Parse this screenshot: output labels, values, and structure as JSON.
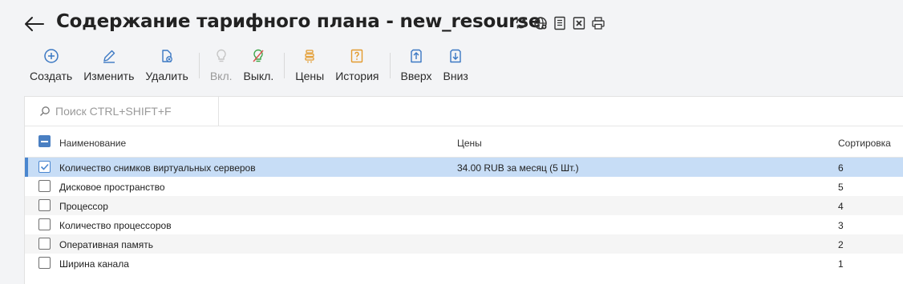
{
  "header": {
    "title": "Содержание тарифного плана - new_resourse",
    "icons": [
      "refresh-icon",
      "globe-icon",
      "document-list-icon",
      "excel-icon",
      "printer-icon"
    ]
  },
  "toolbar": {
    "create": "Создать",
    "edit": "Изменить",
    "delete": "Удалить",
    "enable": "Вкл.",
    "disable": "Выкл.",
    "prices": "Цены",
    "history": "История",
    "up": "Вверх",
    "down": "Вниз"
  },
  "search": {
    "placeholder": "Поиск CTRL+SHIFT+F",
    "value": ""
  },
  "table": {
    "columns": {
      "name": "Наименование",
      "price": "Цены",
      "sort": "Сортировка"
    },
    "rows": [
      {
        "name": "Количество снимков виртуальных серверов",
        "price": "34.00 RUB за месяц (5 Шт.)",
        "sort": "6",
        "checked": true
      },
      {
        "name": "Дисковое пространство",
        "price": "",
        "sort": "5",
        "checked": false
      },
      {
        "name": "Процессор",
        "price": "",
        "sort": "4",
        "checked": false
      },
      {
        "name": "Количество процессоров",
        "price": "",
        "sort": "3",
        "checked": false
      },
      {
        "name": "Оперативная память",
        "price": "",
        "sort": "2",
        "checked": false
      },
      {
        "name": "Ширина канала",
        "price": "",
        "sort": "1",
        "checked": false
      }
    ]
  },
  "colors": {
    "accent": "#4a86cf",
    "selected_row": "#c7ddf6",
    "orange": "#e39a2d",
    "green": "#3aa345",
    "red": "#d9534f"
  }
}
